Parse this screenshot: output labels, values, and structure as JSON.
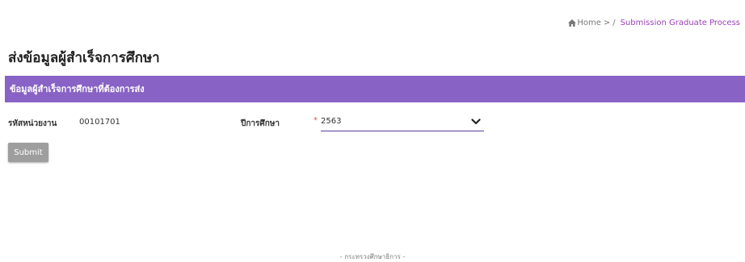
{
  "breadcrumb": {
    "home_label": "Home",
    "separator": ">",
    "slash": "/",
    "current": "Submission Graduate Process"
  },
  "page": {
    "title": "ส่งข้อมูลผู้สำเร็จการศึกษา"
  },
  "panel": {
    "header": "ข้อมูลผู้สำเร็จการศึกษาที่ต้องการส่ง"
  },
  "form": {
    "org_code_label": "รหัสหน่วยงาน",
    "org_code_value": "00101701",
    "year_label": "ปีการศึกษา",
    "required_marker": "*",
    "year_selected": "2563",
    "submit_label": "Submit"
  },
  "footer": {
    "text": "- กระทรวงศึกษาธิการ -"
  },
  "colors": {
    "accent": "#8862c5",
    "breadcrumb_link": "#9b3fb8",
    "required": "#d9534f",
    "button": "#9e9e9e"
  },
  "icons": {
    "home": "home-icon",
    "dropdown": "chevron-down-icon"
  }
}
